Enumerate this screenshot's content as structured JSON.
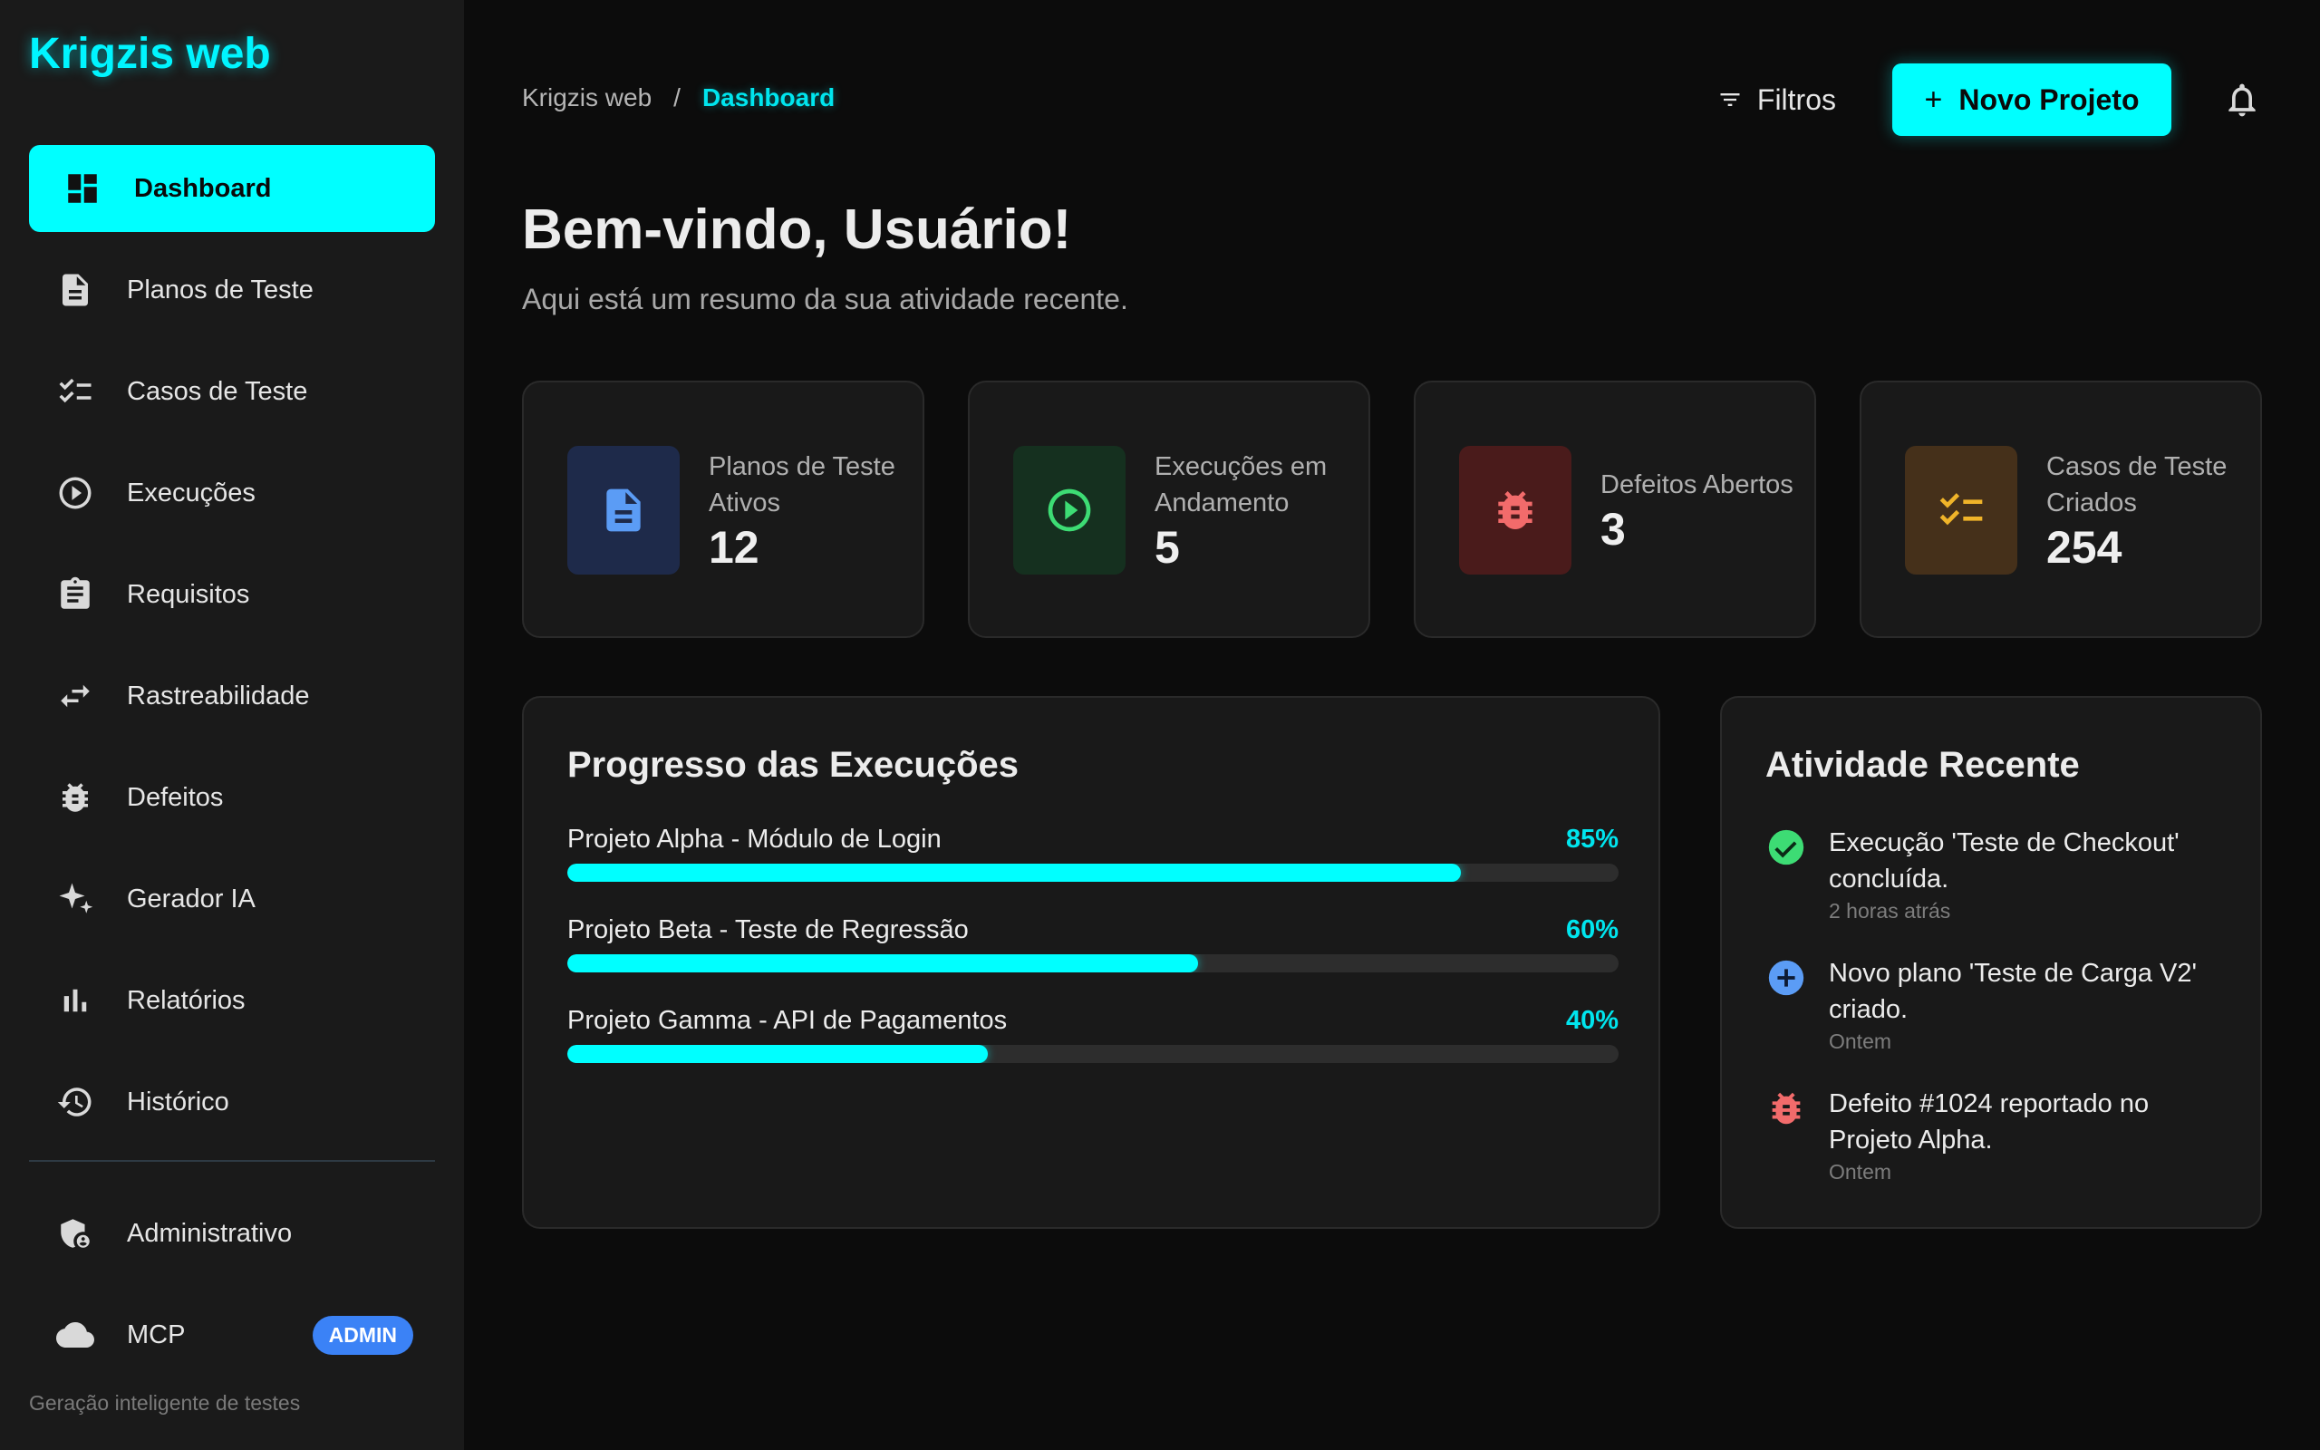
{
  "brand": "Krigzis web",
  "sidebar": {
    "items": [
      {
        "label": "Dashboard",
        "icon": "dashboard-icon"
      },
      {
        "label": "Planos de Teste",
        "icon": "document-icon"
      },
      {
        "label": "Casos de Teste",
        "icon": "checklist-icon"
      },
      {
        "label": "Execuções",
        "icon": "play-circle-icon"
      },
      {
        "label": "Requisitos",
        "icon": "clipboard-icon"
      },
      {
        "label": "Rastreabilidade",
        "icon": "swap-icon"
      },
      {
        "label": "Defeitos",
        "icon": "bug-icon"
      },
      {
        "label": "Gerador IA",
        "icon": "sparkle-icon"
      },
      {
        "label": "Relatórios",
        "icon": "bar-chart-icon"
      },
      {
        "label": "Histórico",
        "icon": "history-icon"
      }
    ],
    "admin_items": [
      {
        "label": "Administrativo",
        "icon": "admin-shield-icon"
      },
      {
        "label": "MCP",
        "icon": "cloud-icon",
        "badge": "ADMIN"
      }
    ],
    "footer": "Geração inteligente de testes"
  },
  "header": {
    "breadcrumb_root": "Krigzis web",
    "breadcrumb_sep": "/",
    "breadcrumb_current": "Dashboard",
    "filter_label": "Filtros",
    "new_project_label": "Novo Projeto",
    "new_project_plus": "+"
  },
  "welcome": {
    "title": "Bem-vindo, Usuário!",
    "subtitle": "Aqui está um resumo da sua atividade recente."
  },
  "stats": [
    {
      "label": "Planos de Teste Ativos",
      "value": "12",
      "icon": "document-icon",
      "bg": "#1e2a4a",
      "color": "#5b9cf5"
    },
    {
      "label": "Execuções em Andamento",
      "value": "5",
      "icon": "play-circle-icon",
      "bg": "#15301f",
      "color": "#3ddc74"
    },
    {
      "label": "Defeitos Abertos",
      "value": "3",
      "icon": "bug-icon",
      "bg": "#4a1b1b",
      "color": "#f26b6b"
    },
    {
      "label": "Casos de Teste Criados",
      "value": "254",
      "icon": "checklist-icon",
      "bg": "#45301a",
      "color": "#f0b429"
    }
  ],
  "progress": {
    "title": "Progresso das Execuções",
    "rows": [
      {
        "name": "Projeto Alpha - Módulo de Login",
        "pct_label": "85%",
        "pct": 0.85
      },
      {
        "name": "Projeto Beta - Teste de Regressão",
        "pct_label": "60%",
        "pct": 0.6
      },
      {
        "name": "Projeto Gamma - API de Pagamentos",
        "pct_label": "40%",
        "pct": 0.4
      }
    ]
  },
  "activity": {
    "title": "Atividade Recente",
    "items": [
      {
        "text": "Execução 'Teste de Checkout' concluída.",
        "time": "2 horas atrás",
        "icon": "check-circle-icon",
        "color": "#3ddc74"
      },
      {
        "text": "Novo plano 'Teste de Carga V2' criado.",
        "time": "Ontem",
        "icon": "plus-circle-icon",
        "color": "#5b9cf5"
      },
      {
        "text": "Defeito #1024 reportado no Projeto Alpha.",
        "time": "Ontem",
        "icon": "bug-icon",
        "color": "#f26b6b"
      }
    ]
  }
}
